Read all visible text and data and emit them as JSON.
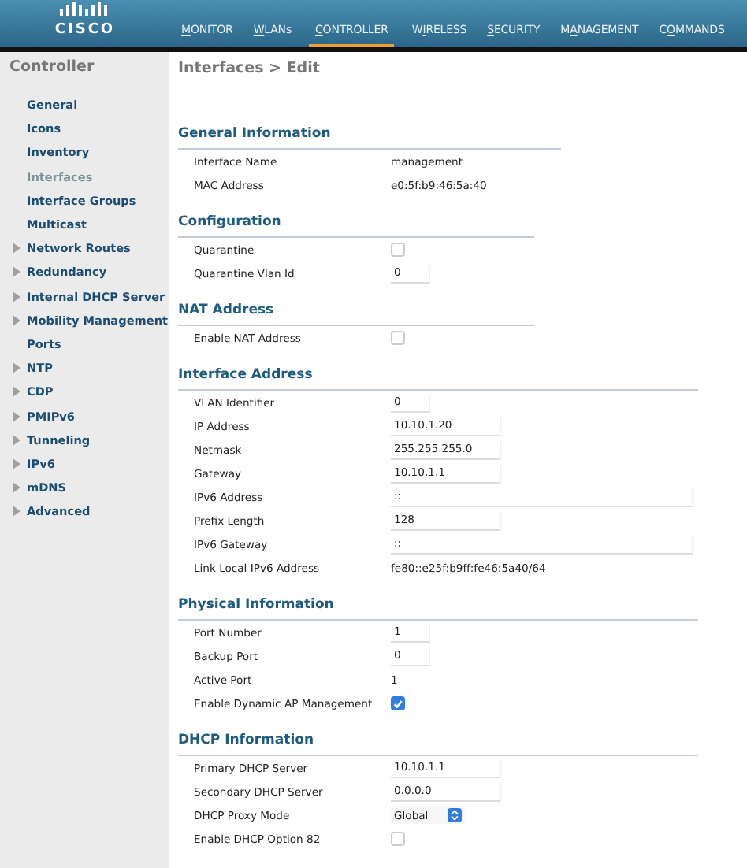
{
  "header": {
    "logo": "CISCO",
    "nav": [
      {
        "segments": [
          {
            "text": "M",
            "underlined": true
          },
          {
            "text": "ONITOR",
            "underlined": false
          }
        ],
        "selected": false
      },
      {
        "segments": [
          {
            "text": "W",
            "underlined": true
          },
          {
            "text": "LANs",
            "underlined": false
          }
        ],
        "selected": false
      },
      {
        "segments": [
          {
            "text": "C",
            "underlined": true
          },
          {
            "text": "ONTROLLER",
            "underlined": false
          }
        ],
        "selected": true
      },
      {
        "segments": [
          {
            "text": "W",
            "underlined": false
          },
          {
            "text": "I",
            "underlined": true
          },
          {
            "text": "RELESS",
            "underlined": false
          }
        ],
        "selected": false
      },
      {
        "segments": [
          {
            "text": "S",
            "underlined": true
          },
          {
            "text": "ECURITY",
            "underlined": false
          }
        ],
        "selected": false
      },
      {
        "segments": [
          {
            "text": "M",
            "underlined": false
          },
          {
            "text": "A",
            "underlined": true
          },
          {
            "text": "NAGEMENT",
            "underlined": false
          }
        ],
        "selected": false
      },
      {
        "segments": [
          {
            "text": "C",
            "underlined": false
          },
          {
            "text": "O",
            "underlined": true
          },
          {
            "text": "MMANDS",
            "underlined": false
          }
        ],
        "selected": false
      }
    ]
  },
  "sidebar": {
    "title": "Controller",
    "items": [
      {
        "label": "General",
        "expandable": false,
        "selected": false
      },
      {
        "label": "Icons",
        "expandable": false,
        "selected": false
      },
      {
        "label": "Inventory",
        "expandable": false,
        "selected": false
      },
      {
        "label": "Interfaces",
        "expandable": false,
        "selected": true
      },
      {
        "label": "Interface Groups",
        "expandable": false,
        "selected": false
      },
      {
        "label": "Multicast",
        "expandable": false,
        "selected": false
      },
      {
        "label": "Network Routes",
        "expandable": true,
        "selected": false
      },
      {
        "label": "Redundancy",
        "expandable": true,
        "selected": false
      },
      {
        "label": "Internal DHCP Server",
        "expandable": true,
        "selected": false
      },
      {
        "label": "Mobility Management",
        "expandable": true,
        "selected": false
      },
      {
        "label": "Ports",
        "expandable": false,
        "selected": false
      },
      {
        "label": "NTP",
        "expandable": true,
        "selected": false
      },
      {
        "label": "CDP",
        "expandable": true,
        "selected": false
      },
      {
        "label": "PMIPv6",
        "expandable": true,
        "selected": false
      },
      {
        "label": "Tunneling",
        "expandable": true,
        "selected": false
      },
      {
        "label": "IPv6",
        "expandable": true,
        "selected": false
      },
      {
        "label": "mDNS",
        "expandable": true,
        "selected": false
      },
      {
        "label": "Advanced",
        "expandable": true,
        "selected": false
      }
    ]
  },
  "page_title": "Interfaces > Edit",
  "sections": [
    {
      "title": "General Information",
      "rows": [
        {
          "kind": "text",
          "label": "Interface Name",
          "value": "management"
        },
        {
          "kind": "text",
          "label": "MAC Address",
          "value": "e0:5f:b9:46:5a:40"
        }
      ]
    },
    {
      "title": "Configuration",
      "rows": [
        {
          "kind": "checkbox",
          "label": "Quarantine",
          "checked": false
        },
        {
          "kind": "short_input",
          "label": "Quarantine Vlan Id",
          "value": "0"
        }
      ]
    },
    {
      "title": "NAT Address",
      "rows": [
        {
          "kind": "checkbox",
          "label": "Enable NAT Address",
          "checked": false
        }
      ]
    },
    {
      "title": "Interface Address",
      "rows": [
        {
          "kind": "short_input",
          "label": "VLAN Identifier",
          "value": "0"
        },
        {
          "kind": "input",
          "label": "IP Address",
          "value": "10.10.1.20"
        },
        {
          "kind": "input",
          "label": "Netmask",
          "value": "255.255.255.0"
        },
        {
          "kind": "input",
          "label": "Gateway",
          "value": "10.10.1.1"
        },
        {
          "kind": "wide_input",
          "label": "IPv6 Address",
          "value": "::"
        },
        {
          "kind": "input",
          "label": "Prefix Length",
          "value": "128"
        },
        {
          "kind": "wide_input",
          "label": "IPv6 Gateway",
          "value": "::"
        },
        {
          "kind": "text",
          "label": "Link Local IPv6 Address",
          "value": "fe80::e25f:b9ff:fe46:5a40/64"
        }
      ]
    },
    {
      "title": "Physical Information",
      "rows": [
        {
          "kind": "short_input",
          "label": "Port Number",
          "value": "1"
        },
        {
          "kind": "short_input",
          "label": "Backup Port",
          "value": "0"
        },
        {
          "kind": "text",
          "label": "Active Port",
          "value": "1"
        },
        {
          "kind": "checkbox",
          "label": "Enable Dynamic AP Management",
          "checked": true
        }
      ]
    },
    {
      "title": "DHCP Information",
      "rows": [
        {
          "kind": "input",
          "label": "Primary DHCP Server",
          "value": "10.10.1.1"
        },
        {
          "kind": "input",
          "label": "Secondary DHCP Server",
          "value": "0.0.0.0"
        },
        {
          "kind": "select",
          "label": "DHCP Proxy Mode",
          "value": "Global"
        },
        {
          "kind": "checkbox",
          "label": "Enable DHCP Option 82",
          "checked": false
        }
      ]
    }
  ]
}
